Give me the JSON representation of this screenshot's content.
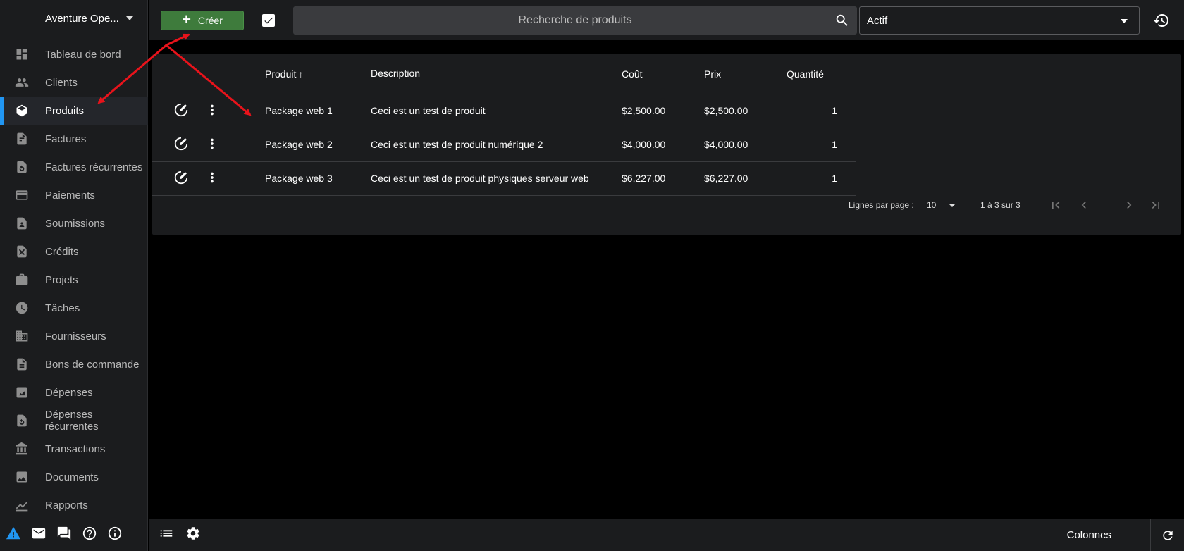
{
  "sidebar": {
    "company": "Aventure Ope...",
    "items": [
      {
        "label": "Tableau de bord",
        "icon": "dashboard-icon"
      },
      {
        "label": "Clients",
        "icon": "people-icon"
      },
      {
        "label": "Produits",
        "icon": "cube-icon",
        "active": true
      },
      {
        "label": "Factures",
        "icon": "invoice-icon"
      },
      {
        "label": "Factures récurrentes",
        "icon": "recurring-invoice-icon"
      },
      {
        "label": "Paiements",
        "icon": "credit-card-icon"
      },
      {
        "label": "Soumissions",
        "icon": "quote-icon"
      },
      {
        "label": "Crédits",
        "icon": "credit-icon"
      },
      {
        "label": "Projets",
        "icon": "briefcase-icon"
      },
      {
        "label": "Tâches",
        "icon": "clock-icon"
      },
      {
        "label": "Fournisseurs",
        "icon": "building-icon"
      },
      {
        "label": "Bons de commande",
        "icon": "purchase-order-icon"
      },
      {
        "label": "Dépenses",
        "icon": "expense-icon"
      },
      {
        "label": "Dépenses récurrentes",
        "icon": "recurring-expense-icon"
      },
      {
        "label": "Transactions",
        "icon": "bank-icon"
      },
      {
        "label": "Documents",
        "icon": "image-icon"
      },
      {
        "label": "Rapports",
        "icon": "chart-icon"
      }
    ]
  },
  "toolbar": {
    "create_label": "Créer",
    "search_placeholder": "Recherche de produits",
    "status_value": "Actif"
  },
  "table": {
    "headers": {
      "product": "Produit",
      "description": "Description",
      "cost": "Coût",
      "price": "Prix",
      "quantity": "Quantité"
    },
    "rows": [
      {
        "product": "Package web 1",
        "description": "Ceci est un test de produit",
        "cost": "$2,500.00",
        "price": "$2,500.00",
        "quantity": "1"
      },
      {
        "product": "Package web 2",
        "description": "Ceci est un test de produit numérique 2",
        "cost": "$4,000.00",
        "price": "$4,000.00",
        "quantity": "1"
      },
      {
        "product": "Package web 3",
        "description": "Ceci est un test de produit physiques serveur web",
        "cost": "$6,227.00",
        "price": "$6,227.00",
        "quantity": "1"
      }
    ]
  },
  "pager": {
    "rows_per_page_label": "Lignes par page :",
    "rows_per_page": "10",
    "range": "1 à 3 sur 3"
  },
  "footer": {
    "columns_label": "Colonnes"
  },
  "colors": {
    "accent": "#2196f3",
    "create_button": "#3e7b3c",
    "annotation": "#e8131b"
  }
}
